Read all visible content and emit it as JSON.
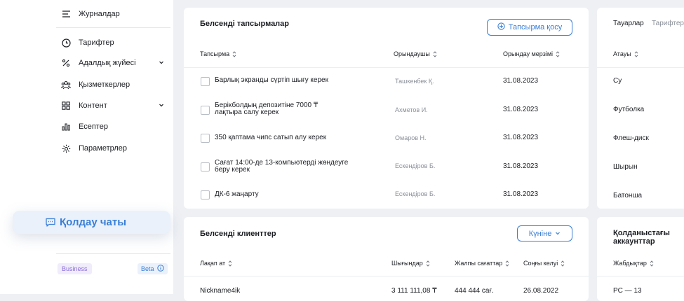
{
  "sidebar": {
    "items": [
      {
        "label": "Журналдар",
        "icon": "list-icon"
      },
      {
        "label": "Тарифтер",
        "icon": "clock-icon"
      },
      {
        "label": "Адалдық жүйесі",
        "icon": "percent-icon"
      },
      {
        "label": "Қызметкерлер",
        "icon": "people-icon"
      },
      {
        "label": "Контент",
        "icon": "grid-icon"
      },
      {
        "label": "Есептер",
        "icon": "bar-chart-icon"
      },
      {
        "label": "Параметрлер",
        "icon": "gear-icon"
      }
    ],
    "support_label": "Қолдау чаты",
    "badge_business": "Business",
    "badge_beta": "Beta"
  },
  "tasks_card": {
    "title": "Белсенді тапсырмалар",
    "add_button": "Тапсырма қосу",
    "columns": [
      "Тапсырма",
      "Орындаушы",
      "Орындау мерзімі"
    ],
    "rows": [
      {
        "task": "Барлық экранды сүртіп шығу керек",
        "assignee": "Ташкенбек Қ.",
        "due": "31.08.2023"
      },
      {
        "task": "Берікболдың депозитіне 7000 ₸ лақтыра салу керек",
        "assignee": "Ахметов И.",
        "due": "31.08.2023"
      },
      {
        "task": "350 қаптама чипс сатып алу керек",
        "assignee": "Омаров Н.",
        "due": "31.08.2023"
      },
      {
        "task": "Сағат 14:00-де 13-компьютерді жөндеуге беру керек",
        "assignee": "Ескендіров Б.",
        "due": "31.08.2023"
      },
      {
        "task": "ДК-6 жаңарту",
        "assignee": "Ескендіров Б.",
        "due": "31.08.2023"
      }
    ]
  },
  "products_card": {
    "tabs": [
      "Тауарлар",
      "Тарифтер"
    ],
    "column": "Атауы",
    "rows": [
      "Су",
      "Футболка",
      "Флеш-диск",
      "Шырын",
      "Батонша"
    ]
  },
  "clients_card": {
    "title": "Белсенді клиенттер",
    "period_select": "Күніне",
    "columns": [
      "Лақап ат",
      "Шығындар",
      "Жалпы сағаттар",
      "Соңғы келуі"
    ],
    "rows": [
      {
        "nick": "Nickname4ik",
        "spend": "3 111 111,08 ₸",
        "hours": "444 444 сағ.",
        "last": "26.08.2022"
      }
    ]
  },
  "accounts_card": {
    "title": "Қолданыстағы аккаунттар",
    "column": "Жабдықтар",
    "rows": [
      "PC — 13"
    ]
  },
  "colors": {
    "accent": "#3a7fd6",
    "background": "#eef0f4",
    "card": "#ffffff"
  }
}
